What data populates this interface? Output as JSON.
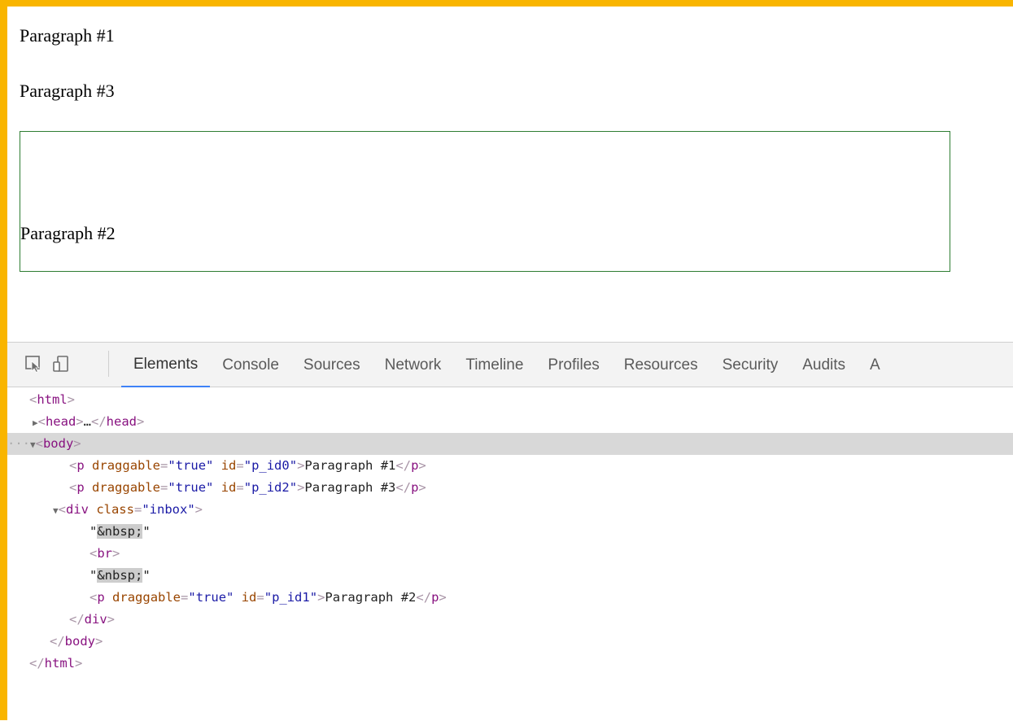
{
  "page": {
    "paragraph_1": "Paragraph #1",
    "paragraph_3": "Paragraph #3",
    "paragraph_2": "Paragraph #2"
  },
  "devtools": {
    "tools": {
      "inspect": "inspect-element-icon",
      "device": "device-toolbar-icon"
    },
    "tabs": [
      "Elements",
      "Console",
      "Sources",
      "Network",
      "Timeline",
      "Profiles",
      "Resources",
      "Security",
      "Audits",
      "A"
    ],
    "active_tab": "Elements",
    "tree": {
      "html_open": "html",
      "head": "head",
      "head_ellipsis": "…",
      "body": "body",
      "p_tag": "p",
      "draggable_attr": "draggable",
      "draggable_value": "\"true\"",
      "id_attr": "id",
      "p1_id": "\"p_id0\"",
      "p1_text": "Paragraph #1",
      "p3_id": "\"p_id2\"",
      "p3_text": "Paragraph #3",
      "div_tag": "div",
      "class_attr": "class",
      "div_class": "\"inbox\"",
      "nbsp": "&nbsp;",
      "br": "br",
      "p2_id": "\"p_id1\"",
      "p2_text": "Paragraph #2",
      "quote": "\""
    },
    "selected_row": "body"
  },
  "colors": {
    "frame": "#f9b500",
    "inbox_border": "#2e7d32",
    "active_tab_underline": "#3e82f7"
  }
}
